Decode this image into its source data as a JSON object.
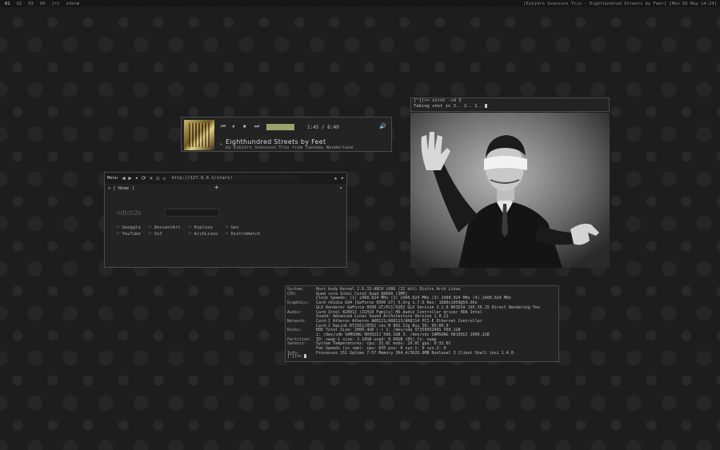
{
  "topbar": {
    "workspaces": [
      "01",
      "02",
      "03",
      "04"
    ],
    "layout": "[=]",
    "active_window": "xterm",
    "status": "[Esbjörn Svensson Trio - Eighthundred Streets by Feet] [Mon 03 May 14:24]"
  },
  "player": {
    "controls": [
      "prev-icon",
      "pause-icon",
      "stop-icon",
      "next-icon"
    ],
    "volume": 1.0,
    "time": "1:45 / 6:49",
    "title": "Eighthundred Streets by Feet",
    "byline": "by Esbjörn Svensson Trio from Tuesday Wonderland"
  },
  "browser": {
    "menu_label": "Menu",
    "url": "http://127.0.0.1/start/",
    "tab_label": "[ Home ]",
    "logo": "n0tch2k",
    "links": [
      "Googgle",
      "DevientArt",
      "Exploze",
      "Gev",
      "YouTube",
      "SvZ",
      "ArchLinux",
      "DistroWatch"
    ]
  },
  "terminal": {
    "line1": "[^])>> scrot -cd 3",
    "line2": "Taking shot in 3.. 2.. 1.. "
  },
  "sysinfo": {
    "rows": [
      {
        "k": "System:",
        "v": "Host kody Kernel 2.6.33-ARCH i686 (32 bit) Distro Arch Linux"
      },
      {
        "k": "CPU:",
        "v": "Quad core Intel Core2 Quad Q6600 (SMP)"
      },
      {
        "k": "",
        "v": "Clock Speeds: (1) 2400.024 MHz (2) 2400.024 MHz (3) 2400.024 MHz (4) 2400.024 MHz"
      },
      {
        "k": "Graphics:",
        "v": "Card nVidia G94 [GeForce 9500 GT] X.Org 1.7.6 Res: 1680x1050@59.9hz"
      },
      {
        "k": "",
        "v": "GLX Renderer GeForce 9500 GT/PCI/SSE2 GLX Version 3.2.0 NVIDIA 195.36.15 Direct Rendering Yes"
      },
      {
        "k": "Audio:",
        "v": "Card Intel 82801I (ICH10 Family) HD Audio Controller driver HDA Intel"
      },
      {
        "k": "",
        "v": "Sound: Advanced Linux Sound Architecture Version 1.0.21"
      },
      {
        "k": "Network:",
        "v": "Card-1 Atheros Atheros AR8121/AR8113/AR8114 PCI-E Ethernet Controller"
      },
      {
        "k": "",
        "v": "Card-2 RaLink RT2561/RT61 rev B 802.11g Bus ID: 05:00.0"
      },
      {
        "k": "Disks:",
        "v": "HDD Total Size: 2000.4GB (-) 1: /dev/sda ST3500320AS 500.1GB"
      },
      {
        "k": "",
        "v": "2: /dev/sdb SAMSUNG HD502IJ 500.1GB 3: /dev/sdc SAMSUNG HD103UJ 1000.2GB"
      },
      {
        "k": "Partition:",
        "v": "ID: swap-1 size: 2.10GB used: 0.00GB (0%) fs: swap"
      },
      {
        "k": "Sensors:",
        "v": "System Temperatures: cpu: 31.0C mobo: 29.0C gpu: 0:33.0C"
      },
      {
        "k": "",
        "v": "Fan Speeds (in rpm): cpu: 835 psu: 0 sys-1: 0 sys-2: 0"
      },
      {
        "k": "Info:",
        "v": "Processes 151 Uptime 7:57 Memory 304.4/3026.9MB Runlevel 3 Client Shell inxi 1.4.8"
      }
    ],
    "prompt": "[^])>> "
  }
}
